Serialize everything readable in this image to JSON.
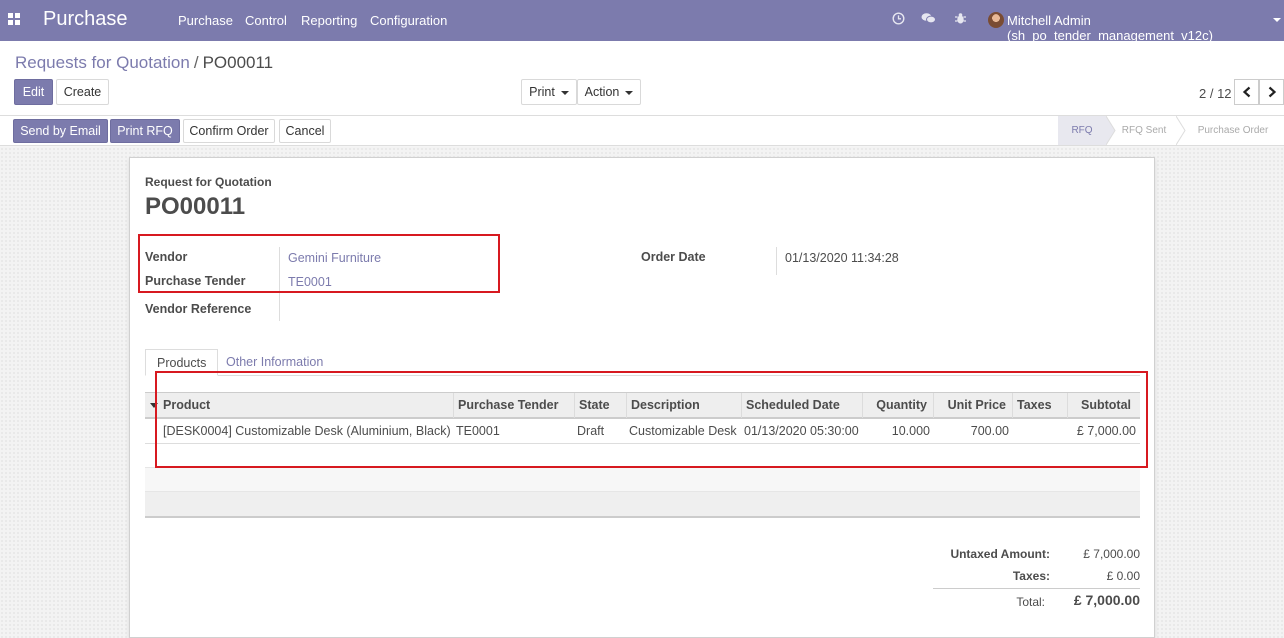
{
  "navbar": {
    "app_title": "Purchase",
    "menu": [
      "Purchase",
      "Control",
      "Reporting",
      "Configuration"
    ],
    "user_name": "Mitchell Admin (sh_po_tender_management_v12c)",
    "icons": [
      "apps-grid-icon",
      "clock-icon",
      "chat-icon",
      "bug-icon",
      "avatar"
    ]
  },
  "breadcrumb": {
    "parent": "Requests for Quotation",
    "separator": "/",
    "current": "PO00011"
  },
  "toolbar": {
    "edit_label": "Edit",
    "create_label": "Create",
    "print_label": "Print",
    "action_label": "Action"
  },
  "pager": {
    "value": "2 / 12"
  },
  "statusbar": {
    "buttons": [
      "Send by Email",
      "Print RFQ",
      "Confirm Order",
      "Cancel"
    ],
    "stages": [
      "RFQ",
      "RFQ Sent",
      "Purchase Order"
    ],
    "active_stage": "RFQ"
  },
  "form": {
    "doc_type": "Request for Quotation",
    "name": "PO00011",
    "vendor_label": "Vendor",
    "vendor_value": "Gemini Furniture",
    "tender_label": "Purchase Tender",
    "tender_value": "TE0001",
    "vendor_ref_label": "Vendor Reference",
    "vendor_ref_value": "",
    "order_date_label": "Order Date",
    "order_date_value": "01/13/2020 11:34:28"
  },
  "tabs": [
    "Products",
    "Other Information"
  ],
  "table": {
    "columns": [
      "Product",
      "Purchase Tender",
      "State",
      "Description",
      "Scheduled Date",
      "Quantity",
      "Unit Price",
      "Taxes",
      "Subtotal"
    ],
    "rows": [
      {
        "product": "[DESK0004] Customizable Desk (Aluminium, Black)",
        "tender": "TE0001",
        "state": "Draft",
        "description": "Customizable Desk",
        "scheduled_date": "01/13/2020 05:30:00",
        "quantity": "10.000",
        "unit_price": "700.00",
        "taxes": "",
        "subtotal": "£ 7,000.00"
      }
    ]
  },
  "totals": {
    "untaxed_label": "Untaxed Amount:",
    "untaxed_value": "£ 7,000.00",
    "taxes_label": "Taxes:",
    "taxes_value": "£ 0.00",
    "total_label": "Total:",
    "total_value": "£ 7,000.00"
  },
  "colors": {
    "brand": "#7c7bad",
    "highlight_border": "#d71920"
  }
}
